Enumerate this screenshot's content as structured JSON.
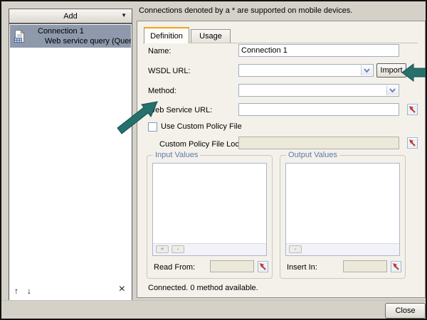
{
  "notice": "Connections denoted by a * are supported on mobile devices.",
  "sidebar": {
    "add_label": "Add",
    "connection": {
      "title": "Connection 1",
      "subtitle": "Web service query (Query as a W"
    }
  },
  "tabs": {
    "definition": "Definition",
    "usage": "Usage"
  },
  "form": {
    "name_label": "Name:",
    "name_value": "Connection 1",
    "wsdl_url_label": "WSDL URL:",
    "wsdl_url_value": "",
    "import_label": "Import",
    "method_label": "Method:",
    "method_value": "",
    "web_service_url_label": "Web Service URL:",
    "web_service_url_value": "",
    "use_custom_policy_label": "Use Custom Policy File",
    "custom_policy_location_label": "Custom Policy File Location:",
    "custom_policy_location_value": ""
  },
  "input_values": {
    "title": "Input Values",
    "add_label": "+",
    "remove_label": "-",
    "read_from_label": "Read From:",
    "read_from_value": ""
  },
  "output_values": {
    "title": "Output Values",
    "remove_label": "-",
    "insert_in_label": "Insert In:",
    "insert_in_value": ""
  },
  "status": "Connected. 0 method available.",
  "close_label": "Close",
  "colors": {
    "annotation_arrow": "#26706D",
    "active_tab_accent": "#EFA11C",
    "selected_item_bg": "#8E99AC",
    "panel_bg": "#F4F1EA",
    "disabled_field_bg": "#ECE8DA"
  }
}
